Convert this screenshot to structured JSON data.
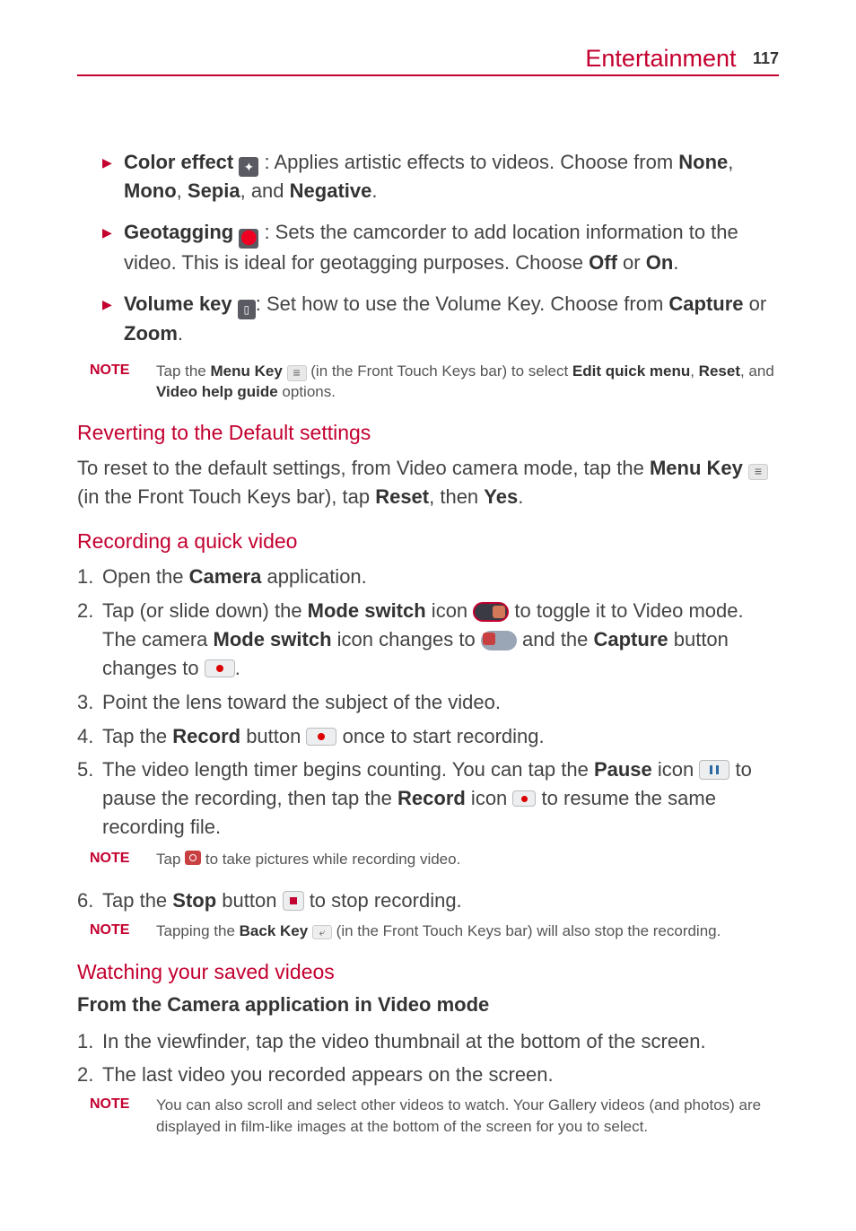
{
  "header": {
    "title": "Entertainment",
    "page": "117"
  },
  "bullets": {
    "color": {
      "label": "Color effect",
      "tail": " : Applies artistic effects to videos. Choose from ",
      "opt1": "None",
      "sep1": ", ",
      "opt2": "Mono",
      "sep2": ", ",
      "opt3": "Sepia",
      "sep3": ", and ",
      "opt4": "Negative",
      "end": "."
    },
    "geo": {
      "label": "Geotagging",
      "tail": " : Sets the camcorder to add location information to the video. This is ideal for geotagging purposes. Choose ",
      "opt1": "Off",
      "sep": " or ",
      "opt2": "On",
      "end": "."
    },
    "vol": {
      "label": "Volume key",
      "tail": ": Set how to use the Volume Key. Choose from ",
      "opt1": "Capture",
      "sep": " or ",
      "opt2": "Zoom",
      "end": "."
    }
  },
  "note1": {
    "label": "NOTE",
    "t1": "Tap the ",
    "b1": "Menu Key",
    "t2": " (in the Front Touch Keys bar) to select ",
    "b2": "Edit quick menu",
    "c1": ", ",
    "b3": "Reset",
    "c2": ", and ",
    "b4": "Video help guide",
    "t3": " options."
  },
  "revert": {
    "h": "Reverting to the Default settings",
    "p1": "To reset to the default settings, from Video camera mode, tap the ",
    "b1": "Menu Key",
    "p2": " (in the Front Touch Keys bar), tap ",
    "b2": "Reset",
    "p3": ", then ",
    "b3": "Yes",
    "p4": "."
  },
  "record": {
    "h": "Recording a quick video",
    "s1": {
      "n": "1.",
      "t1": "Open the ",
      "b1": "Camera",
      "t2": " application."
    },
    "s2": {
      "n": "2.",
      "t1": "Tap (or slide down) the ",
      "b1": "Mode switch",
      "t2": " icon ",
      "t3": " to toggle it to Video mode. The camera ",
      "b2": "Mode switch",
      "t4": " icon changes to ",
      "t5": " and the ",
      "b3": "Capture",
      "t6": " button changes to ",
      "t7": "."
    },
    "s3": {
      "n": "3.",
      "t1": "Point the lens toward the subject of the video."
    },
    "s4": {
      "n": "4.",
      "t1": "Tap the ",
      "b1": "Record",
      "t2": " button ",
      "t3": " once to start recording."
    },
    "s5": {
      "n": "5.",
      "t1": "The video length timer begins counting. You can tap the ",
      "b1": "Pause",
      "t2": " icon ",
      "t3": " to pause the recording, then tap the ",
      "b2": "Record",
      "t4": " icon ",
      "t5": " to resume the same recording file."
    },
    "note2": {
      "label": "NOTE",
      "t1": "Tap ",
      "t2": " to take pictures while recording video."
    },
    "s6": {
      "n": "6.",
      "t1": "Tap the ",
      "b1": "Stop",
      "t2": " button ",
      "t3": " to stop recording."
    },
    "note3": {
      "label": "NOTE",
      "t1": "Tapping the ",
      "b1": "Back Key",
      "t2": " (in the Front Touch Keys bar) will also stop the recording."
    }
  },
  "watch": {
    "h": "Watching your saved videos",
    "sub": "From the Camera application in Video mode",
    "s1": {
      "n": "1.",
      "t": "In the viewfinder, tap the video thumbnail at the bottom of the screen."
    },
    "s2": {
      "n": "2.",
      "t": "The last video you recorded appears on the screen."
    },
    "note4": {
      "label": "NOTE",
      "t": "You can also scroll and select other videos to watch. Your Gallery videos (and photos) are displayed in film-like images at the bottom of the screen for you to select."
    }
  }
}
